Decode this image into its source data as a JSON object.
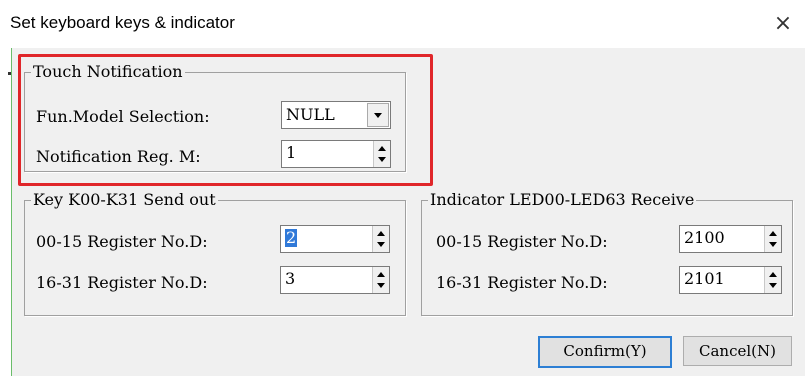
{
  "window": {
    "title": "Set keyboard keys & indicator",
    "close_symbol": "×"
  },
  "touch_notification": {
    "legend": "Touch Notification",
    "fun_model_label": "Fun.Model Selection:",
    "fun_model_value": "NULL",
    "notification_reg_label": "Notification Reg. M:",
    "notification_reg_value": "1"
  },
  "key_send": {
    "legend": "Key K00-K31 Send out",
    "row1_label": "00-15 Register No.D:",
    "row1_value": "2",
    "row2_label": "16-31 Register No.D:",
    "row2_value": "3"
  },
  "indicator_receive": {
    "legend": "Indicator LED00-LED63 Receive",
    "row1_label": "00-15 Register No.D:",
    "row1_value": "2100",
    "row2_label": "16-31 Register No.D:",
    "row2_value": "2101"
  },
  "buttons": {
    "confirm": "Confirm(Y)",
    "cancel": "Cancel(N)"
  },
  "colors": {
    "highlight": "#e0262a",
    "selection": "#3079d8",
    "default_button_border": "#2d7fd4"
  }
}
